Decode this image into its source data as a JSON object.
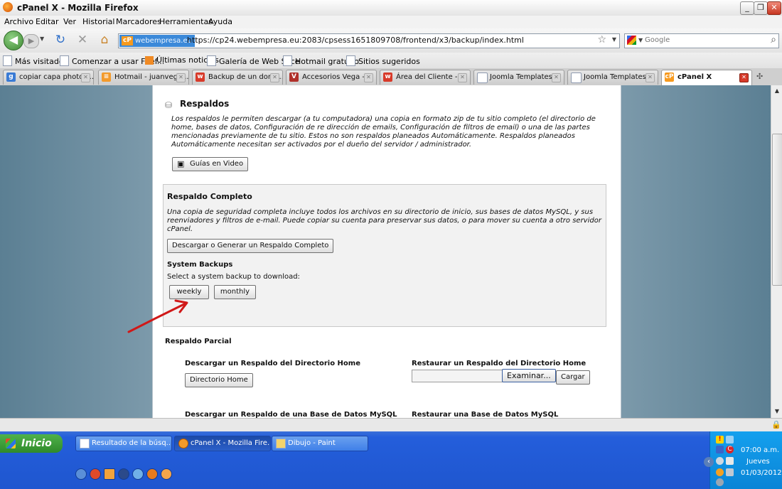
{
  "window": {
    "title": "cPanel X - Mozilla Firefox",
    "min_label": "_",
    "max_label": "❐",
    "close_label": "✕"
  },
  "menu": [
    "Archivo",
    "Editar",
    "Ver",
    "Historial",
    "Marcadores",
    "Herramientas",
    "Ayuda"
  ],
  "nav": {
    "identity": "webempresa.eu",
    "identity_icon_label": "cP",
    "url": "https://cp24.webempresa.eu:2083/cpsess1651809708/frontend/x3/backup/index.html",
    "search_placeholder": "Google"
  },
  "bookmarks": [
    "Más visitados",
    "Comenzar a usar Firef...",
    "Últimas noticias",
    "Galería de Web Slice",
    "Hotmail gratuito",
    "Sitios sugeridos"
  ],
  "tabs": [
    {
      "label": "copiar capa photos..."
    },
    {
      "label": "Hotmail - juanvega..."
    },
    {
      "label": "Backup de un domi..."
    },
    {
      "label": "Accesorios Vega - ..."
    },
    {
      "label": "Área del Cliente - ..."
    },
    {
      "label": "Joomla Templates ..."
    },
    {
      "label": "Joomla Templates ..."
    },
    {
      "label": "cPanel X"
    }
  ],
  "page": {
    "heading": "Respaldos",
    "intro_lines": [
      "Los respaldos le permiten descargar (a tu computadora) una copia en formato zip de tu sitio completo (el directorio de",
      "home, bases de datos, Configuración de re dirección de emails, Configuración de filtros de email) o una de las partes",
      "mencionadas previamente de tu sitio. Estos no son respaldos planeados Automáticamente. Respaldos planeados",
      "Automáticamente necesitan ser activados por el dueño del servidor / administrador."
    ],
    "video_button": "Guías en Video",
    "full_backup": {
      "title": "Respaldo Completo",
      "desc_lines": [
        "Una copia de seguridad completa incluye todos los archivos en su directorio de inicio, sus bases de datos MySQL, y sus",
        "reenviadores y filtros de e-mail. Puede copiar su cuenta para preservar sus datos, o para mover su cuenta a otro servidor",
        "cPanel."
      ],
      "button": "Descargar o Generar un Respaldo Completo"
    },
    "system_backups": {
      "title": "System Backups",
      "prompt": "Select a system backup to download:",
      "weekly": "weekly",
      "monthly": "monthly"
    },
    "partial": {
      "title": "Respaldo Parcial",
      "home_download_title": "Descargar un Respaldo del Directorio Home",
      "home_download_button": "Directorio Home",
      "home_restore_title": "Restaurar un Respaldo del Directorio Home",
      "browse_button": "Examinar...",
      "upload_button": "Cargar",
      "db_download_title": "Descargar un Respaldo de una Base de Datos MySQL",
      "db_restore_title": "Restaurar una Base de Datos MySQL"
    }
  },
  "taskbar": {
    "start": "Inicio",
    "items": [
      "Resultado de la búsq...",
      "cPanel X - Mozilla Fire...",
      "Dibujo - Paint"
    ],
    "time": "07:00 a.m.",
    "day": "Jueves",
    "date": "01/03/2012"
  },
  "colors": {
    "arrow": "#d01818",
    "identity": "#3b89d9",
    "taskbar": "#245edb"
  }
}
